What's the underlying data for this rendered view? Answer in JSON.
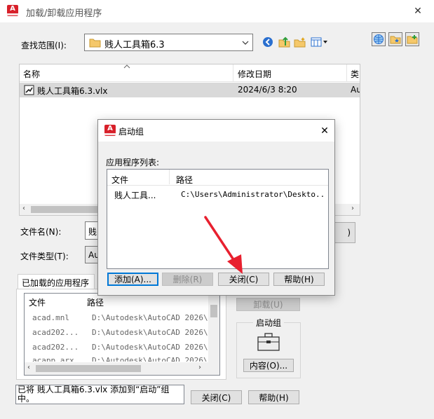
{
  "window": {
    "title": "加载/卸载应用程序",
    "close_glyph": "✕"
  },
  "lookin": {
    "label": "查找范围(I):",
    "value": "贱人工具箱6.3"
  },
  "file_list": {
    "columns": [
      "名称",
      "修改日期",
      "类"
    ],
    "rows": [
      {
        "name": "贱人工具箱6.3.vlx",
        "date": "2024/6/3 8:20",
        "type": "Au"
      }
    ]
  },
  "filename": {
    "label": "文件名(N):",
    "value": "贱"
  },
  "filetype": {
    "label": "文件类型(T):",
    "value": "Au"
  },
  "loaded_apps": {
    "tab_label": "已加载的应用程序",
    "columns": [
      "文件",
      "路径"
    ],
    "rows": [
      {
        "file": "acad.mnl",
        "path": "D:\\Autodesk\\AutoCAD 2026\\..."
      },
      {
        "file": "acad202...",
        "path": "D:\\Autodesk\\AutoCAD 2026\\..."
      },
      {
        "file": "acad202...",
        "path": "D:\\Autodesk\\AutoCAD 2026\\..."
      },
      {
        "file": "acapp.arx",
        "path": "D:\\Autodesk\\AutoCAD 2026\\..."
      }
    ]
  },
  "right_panel": {
    "unload_label": "卸载(U)",
    "startup_group_label": "启动组",
    "contents_label": "内容(O)..."
  },
  "status_message": "已将 贱人工具箱6.3.vlx 添加到“启动”组中。",
  "bottom_buttons": {
    "close_label": "关闭(C)",
    "help_label": "帮助(H)"
  },
  "dialog": {
    "title": "启动组",
    "close_glyph": "✕",
    "list_label": "应用程序列表:",
    "columns": [
      "文件",
      "路径"
    ],
    "rows": [
      {
        "file": "贱人工具...",
        "path": "C:\\Users\\Administrator\\Deskto..."
      }
    ],
    "buttons": {
      "add": "添加(A)...",
      "remove": "删除(R)",
      "close": "关闭(C)",
      "help": "帮助(H)"
    }
  },
  "colors": {
    "brand": "#d8202a",
    "arrow": "#e8202f",
    "focus_border": "#0078d7"
  },
  "icons": [
    "app-logo-icon",
    "folder-icon",
    "back-icon",
    "up-folder-icon",
    "new-folder-icon",
    "view-menu-icon",
    "web-icon",
    "favorites-icon",
    "add-favorite-icon",
    "vlx-file-icon",
    "briefcase-icon",
    "sort-arrow-icon"
  ]
}
